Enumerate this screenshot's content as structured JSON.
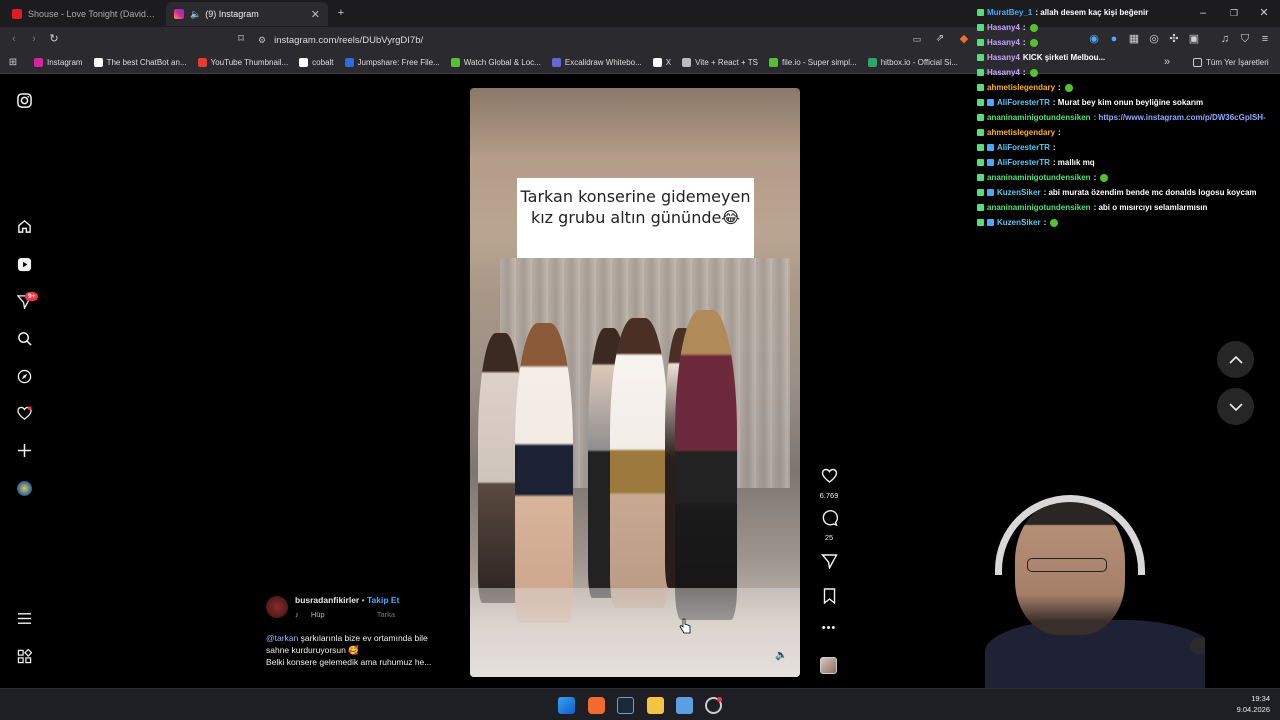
{
  "tabs": [
    {
      "title": "Shouse - Love Tonight (David Guetta",
      "color": "#e01b24"
    },
    {
      "title": "(9) Instagram",
      "color": "#d6249f"
    }
  ],
  "url": "instagram.com/reels/DUbVyrgDI7b/",
  "bookmarks": [
    {
      "label": "Instagram",
      "color": "#d6249f"
    },
    {
      "label": "The best ChatBot an...",
      "color": "#ffffff"
    },
    {
      "label": "YouTube Thumbnail...",
      "color": "#e63b2e"
    },
    {
      "label": "cobalt",
      "color": "#ffffff"
    },
    {
      "label": "Jumpshare: Free File...",
      "color": "#2d6be0"
    },
    {
      "label": "Watch Global & Loc...",
      "color": "#53c22e"
    },
    {
      "label": "Excalidraw Whitebo...",
      "color": "#6965db"
    },
    {
      "label": "X",
      "color": "#ffffff"
    },
    {
      "label": "Vite + React + TS",
      "color": "#bbbbbb"
    },
    {
      "label": "file.io - Super simpl...",
      "color": "#53c22e"
    },
    {
      "label": "hitbox.io - Official Si...",
      "color": "#2fa36b"
    }
  ],
  "bookmarks_folder": "Tüm Yer İşaretleri",
  "sidebar": {
    "notification_badge": "9+"
  },
  "reel": {
    "overlay_text": "Tarkan konserine gidemeyen kız grubu altın gününde😂",
    "likes": "6.769",
    "comments": "25",
    "author": "busradanfikirler",
    "follow_label": "Takip Et",
    "audio": "Hüp",
    "audio_artist": "Tarka",
    "caption_mention": "@tarkan",
    "caption_line1": " şarkılarınla bize ev ortamında bile",
    "caption_line2": "sahne kurduruyorsun 🥰",
    "caption_line3": "Belki konsere gelemedik ama ruhumuz he..."
  },
  "chat": [
    {
      "user": "MuratBey_1",
      "text": ": allah desem kaç kişi beğenir",
      "color": "#4aa8ff",
      "emote": false
    },
    {
      "user": "Hasany4",
      "text": ":",
      "color": "#c7a2ff",
      "emote": true
    },
    {
      "user": "Hasany4",
      "text": ":",
      "color": "#c7a2ff",
      "emote": true
    },
    {
      "user": "Hasany4",
      "text": "KICK şirketi Melbou...",
      "color": "#c7a2ff",
      "emote": false
    },
    {
      "user": "Hasany4",
      "text": ":",
      "color": "#c7a2ff",
      "emote": true
    },
    {
      "user": "ahmetislegendary",
      "text": ":",
      "color": "#ffb020",
      "emote": true
    },
    {
      "user": "AliForesterTR",
      "text": ": Murat bey kim onun beyliğine sokarım",
      "color": "#55c9f5",
      "emote": false
    },
    {
      "user": "ananinaminigotundensiken",
      "text": ": https://www.instagram.com/p/DW36cGpISH-",
      "color": "#53e07a",
      "emote": false
    },
    {
      "user": "ahmetislegendary",
      "text": ":",
      "color": "#ffb020",
      "emote": false
    },
    {
      "user": "AliForesterTR",
      "text": ":",
      "color": "#55c9f5",
      "emote": false
    },
    {
      "user": "AliForesterTR",
      "text": ": mallık mq",
      "color": "#55c9f5",
      "emote": false
    },
    {
      "user": "ananinaminigotundensiken",
      "text": ":",
      "color": "#53e07a",
      "emote": true
    },
    {
      "user": "KuzenSiker",
      "text": ": abi murata özendim bende mc donalds logosu koycam",
      "color": "#55c9f5",
      "emote": false
    },
    {
      "user": "ananinaminigotundensiken",
      "text": ": abi o mısırcıyı selamlarmısın",
      "color": "#53e07a",
      "emote": false
    },
    {
      "user": "KuzenSiker",
      "text": ":",
      "color": "#55c9f5",
      "emote": true
    }
  ],
  "taskbar": {
    "time": "19:34",
    "date": "9.04.2026"
  }
}
